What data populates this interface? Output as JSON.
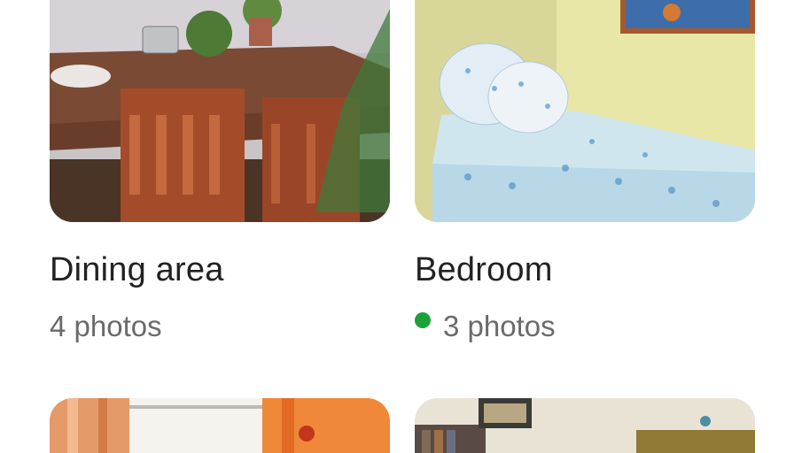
{
  "rooms": [
    {
      "title": "Dining area",
      "count": "4 photos",
      "new_indicator": false
    },
    {
      "title": "Bedroom",
      "count": "3 photos",
      "new_indicator": true,
      "indicator_color": "#1aa137"
    },
    {
      "title": "",
      "count": ""
    },
    {
      "title": "",
      "count": ""
    }
  ],
  "colors": {
    "text_primary": "#222222",
    "text_secondary": "#6a6a6a",
    "indicator": "#1aa137"
  }
}
